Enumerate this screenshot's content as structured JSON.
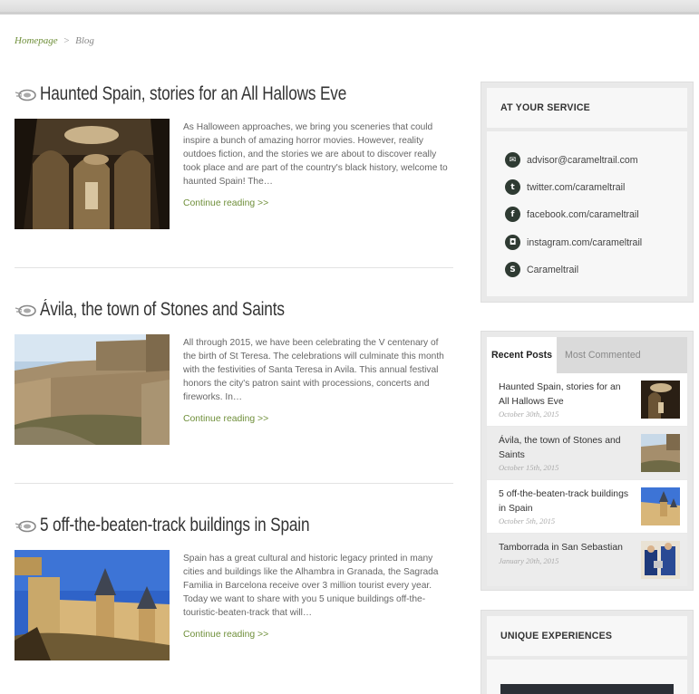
{
  "breadcrumb": {
    "home": "Homepage",
    "separator": ">",
    "current": "Blog"
  },
  "posts": [
    {
      "title": "Haunted Spain, stories for an All Hallows Eve",
      "excerpt": "As Halloween approaches, we bring you sceneries that could inspire a bunch of amazing horror movies. However, reality outdoes fiction, and the stories we are about to discover really took place and are part of the country's black history, welcome to haunted Spain! The…",
      "more": "Continue reading >>"
    },
    {
      "title": "Ávila, the town of Stones and Saints",
      "excerpt": "All through 2015, we have been celebrating the V centenary of the birth of St Teresa. The celebrations will culminate this month with the festivities of Santa Teresa in Avila. This annual festival honors the city's patron saint with processions, concerts and fireworks. In…",
      "more": "Continue reading >>"
    },
    {
      "title": "5 off-the-beaten-track buildings in Spain",
      "excerpt": "Spain has a great cultural and historic legacy printed in many cities and buildings like the Alhambra in Granada, the Sagrada Familia in Barcelona receive over 3 million tourist every year. Today we want to share with you 5 unique buildings off-the-touristic-beaten-track that will…",
      "more": "Continue reading >>"
    }
  ],
  "service": {
    "title": "AT YOUR SERVICE",
    "items": [
      {
        "icon": "email-icon",
        "text": "advisor@carameltrail.com"
      },
      {
        "icon": "twitter-icon",
        "text": "twitter.com/carameltrail"
      },
      {
        "icon": "facebook-icon",
        "text": "facebook.com/carameltrail"
      },
      {
        "icon": "instagram-icon",
        "text": "instagram.com/carameltrail"
      },
      {
        "icon": "skype-icon",
        "text": "Carameltrail"
      }
    ]
  },
  "tabs": {
    "recent": "Recent Posts",
    "commented": "Most Commented"
  },
  "recent": [
    {
      "title": "Haunted Spain, stories for an All Hallows Eve",
      "date": "October 30th, 2015"
    },
    {
      "title": "Ávila, the town of Stones and Saints",
      "date": "October 15th, 2015"
    },
    {
      "title": "5 off-the-beaten-track buildings in Spain",
      "date": "October 5th, 2015"
    },
    {
      "title": "Tamborrada in San Sebastian",
      "date": "January 20th, 2015"
    }
  ],
  "unique": {
    "title": "UNIQUE EXPERIENCES"
  },
  "colors": {
    "link": "#6f8f3a",
    "title": "#333333",
    "widget_bg": "#e9e9e9"
  }
}
